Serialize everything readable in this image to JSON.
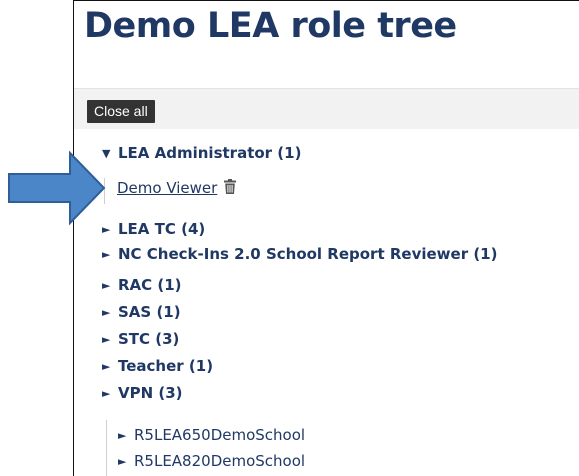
{
  "page": {
    "title": "Demo LEA role tree"
  },
  "toolbar": {
    "close_all_label": "Close all"
  },
  "tree": {
    "expanded_glyph": "▼",
    "collapsed_glyph": "►",
    "expanded_role": {
      "label": "LEA Administrator (1)",
      "members": [
        {
          "name": "Demo Viewer",
          "action_icon": "trash-icon"
        }
      ]
    },
    "roles": [
      {
        "label": "LEA TC (4)"
      },
      {
        "label": "NC Check-Ins 2.0 School Report Reviewer (1)"
      },
      {
        "label": "RAC (1)"
      },
      {
        "label": "SAS (1)"
      },
      {
        "label": "STC (3)"
      },
      {
        "label": "Teacher (1)"
      },
      {
        "label": "VPN (3)"
      }
    ],
    "schools": [
      {
        "label": "R5LEA650DemoSchool"
      },
      {
        "label": "R5LEA820DemoSchool"
      }
    ]
  },
  "callout": {
    "icon": "arrow-right-icon",
    "fill_color": "#4a86c8",
    "stroke_color": "#2f5f96"
  },
  "colors": {
    "heading": "#1f3864",
    "button_bg": "#333333",
    "toolbar_bg": "#f2f2f2"
  }
}
